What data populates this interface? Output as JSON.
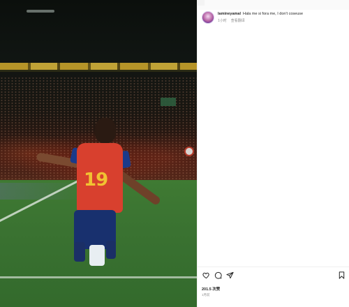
{
  "post": {
    "photo": {
      "jersey_number": "19"
    },
    "caption": {
      "username": "lamineyamal",
      "text": "Hala me si fora me, I don't coseuse",
      "timestamp": "1小时",
      "reply_label": "查看翻译"
    },
    "actions": {
      "like_icon": "heart-icon",
      "comment_icon": "comment-icon",
      "share_icon": "share-icon",
      "save_icon": "bookmark-icon"
    },
    "likes_text": "201.5 次赞",
    "date_text": "1月前"
  }
}
